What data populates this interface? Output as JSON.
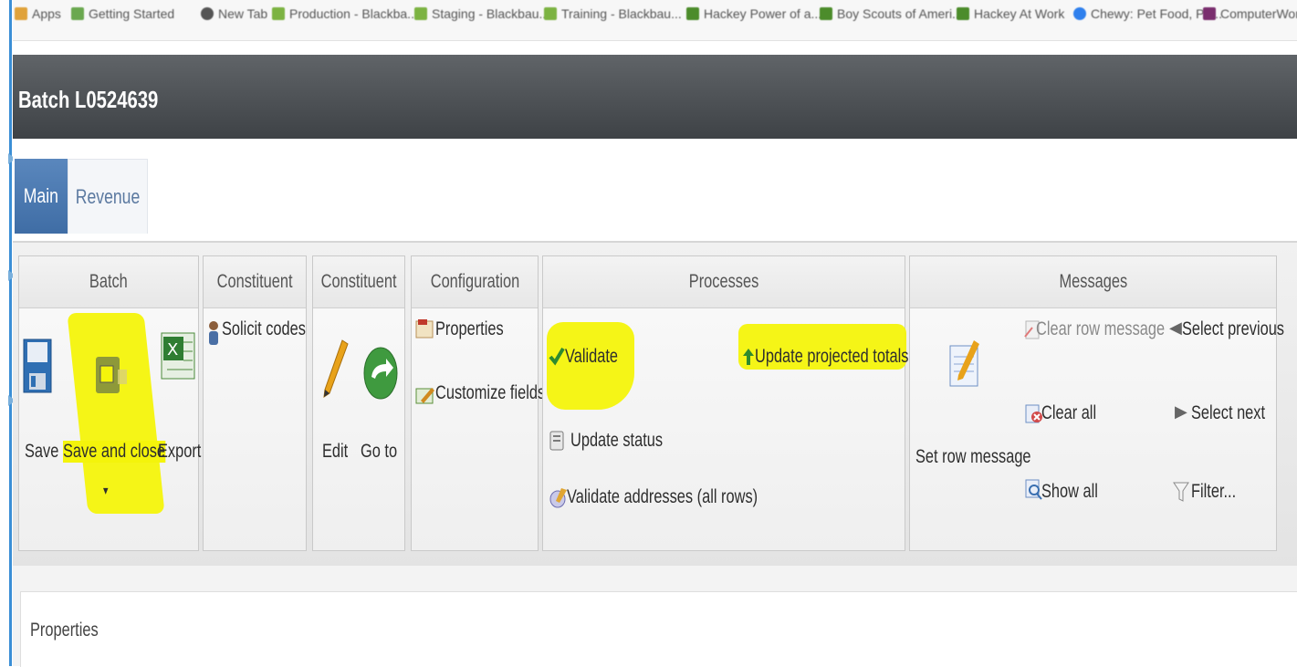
{
  "bookmarks": [
    "Apps",
    "Getting Started",
    "New Tab",
    "Production - Blackba...",
    "Staging - Blackbau...",
    "Training - Blackbau...",
    "Hackey Power of a...",
    "Boy Scouts of Ameri...",
    "Hackey At Work",
    "Chewy: Pet Food, Pe...",
    "ComputerWorld"
  ],
  "window": {
    "title": "Batch L0524639"
  },
  "tabs": {
    "main": "Main",
    "revenue": "Revenue"
  },
  "ribbon": {
    "batch": {
      "header": "Batch",
      "save": "Save",
      "save_and_close": "Save and close",
      "dropdown": "▾",
      "export": "Export"
    },
    "constituent1": {
      "header": "Constituent",
      "solicit_codes": "Solicit codes"
    },
    "constituent2": {
      "header": "Constituent",
      "edit": "Edit",
      "go_to": "Go to"
    },
    "configuration": {
      "header": "Configuration",
      "properties": "Properties",
      "customize_fields": "Customize fields"
    },
    "processes": {
      "header": "Processes",
      "validate": "Validate",
      "update_projected_totals": "Update projected totals",
      "update_status": "Update status",
      "validate_addresses": "Validate addresses (all rows)"
    },
    "messages": {
      "header": "Messages",
      "set_row_message": "Set row message",
      "clear_row_message": "Clear row message",
      "clear_all": "Clear all",
      "show_all": "Show all",
      "select_previous": "Select previous",
      "select_next": "Select next",
      "filter": "Filter..."
    }
  },
  "properties": {
    "label": "Properties"
  },
  "colors": {
    "highlight": "#f4f40b",
    "tab_active": "#4a79b1",
    "title_bar": "#4a4e52"
  }
}
